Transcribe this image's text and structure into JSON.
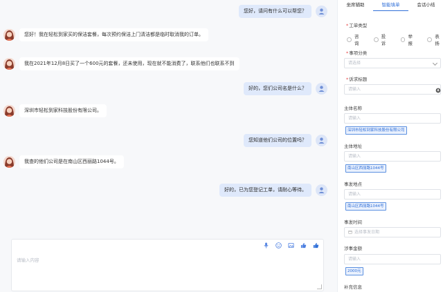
{
  "chat": {
    "messages": [
      {
        "role": "user",
        "text": "您好，请问有什么可以帮您？"
      },
      {
        "role": "bot",
        "text": "您好！我在轻松到家买的保洁套餐，每次预约保洁上门清洁都是临时取消我的订单。"
      },
      {
        "role": "bot",
        "text": "我在2021年12月8日买了一个600元的套餐，还未使用，现在就不能消费了，联系他们也联系不到"
      },
      {
        "role": "user",
        "text": "好的，您们公司名是什么？"
      },
      {
        "role": "bot",
        "text": "深圳市轻松到家科技股份有限公司。"
      },
      {
        "role": "user",
        "text": "您知道他们公司的位置吗？"
      },
      {
        "role": "bot",
        "text": "我查的他们公司是在南山区西丽路1044号。"
      },
      {
        "role": "user",
        "text": "好的，已为您登记工单，请耐心等待。"
      }
    ],
    "composer_placeholder": "请输入内容"
  },
  "panel": {
    "tabs": [
      "坐席辅助",
      "智能填单",
      "会话小结"
    ],
    "active_tab": 1,
    "order_type_label": "工单类型",
    "order_types": [
      "咨询",
      "投诉",
      "举报",
      "表扬"
    ],
    "category_label": "事项分类",
    "category_placeholder": "请选择",
    "title_label": "诉求标题",
    "title_placeholder": "请输入",
    "subject_label": "主体名称",
    "subject_placeholder": "请输入",
    "subject_chip": "深圳市轻松到家科技股份有限公司",
    "main_addr_label": "主体地址",
    "main_addr_placeholder": "请输入",
    "main_addr_chip": "南山区西丽路1044号",
    "event_addr_label": "事发地点",
    "event_addr_placeholder": "请输入",
    "event_addr_chip": "南山区西丽路1044号",
    "event_time_label": "事发时间",
    "event_time_placeholder": "选择事发日期",
    "amount_label": "涉事金额",
    "amount_placeholder": "请输入",
    "amount_chip": "2000元",
    "extra_label": "补充信息"
  }
}
